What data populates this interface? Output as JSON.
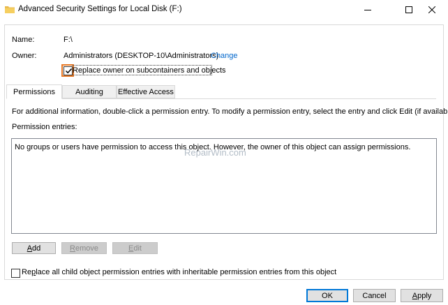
{
  "window": {
    "title": "Advanced Security Settings for Local Disk (F:)",
    "controls": {
      "minimize": "minimize",
      "maximize": "maximize",
      "close": "close"
    }
  },
  "header": {
    "name_label": "Name:",
    "name_value": "F:\\",
    "owner_label": "Owner:",
    "owner_value": "Administrators (DESKTOP-10\\Administrators)",
    "change_link": "Change",
    "replace_owner_label": "Replace owner on subcontainers and objects",
    "replace_owner_checked": true
  },
  "tabs": [
    {
      "label": "Permissions",
      "active": true
    },
    {
      "label": "Auditing",
      "active": false
    },
    {
      "label": "Effective Access",
      "active": false
    }
  ],
  "permissions": {
    "info_text": "For additional information, double-click a permission entry. To modify a permission entry, select the entry and click Edit (if available).",
    "entries_label": "Permission entries:",
    "empty_message": "No groups or users have permission to access this object. However, the owner of this object can assign permissions.",
    "watermark": "RepairWin.com",
    "buttons": {
      "add": {
        "prefix": "",
        "underline": "A",
        "suffix": "dd",
        "enabled": true
      },
      "remove": {
        "prefix": "",
        "underline": "R",
        "suffix": "emove",
        "enabled": false
      },
      "edit": {
        "prefix": "",
        "underline": "E",
        "suffix": "dit",
        "enabled": false
      }
    },
    "replace_child": {
      "prefix": "Re",
      "underline": "p",
      "suffix": "lace all child object permission entries with inheritable permission entries from this object",
      "checked": false
    }
  },
  "footer": {
    "ok": "OK",
    "cancel": "Cancel",
    "apply": {
      "prefix": "",
      "underline": "A",
      "suffix": "pply"
    }
  },
  "colors": {
    "link": "#0066cc",
    "highlight": "#e87722",
    "default_button_border": "#0078d7"
  }
}
